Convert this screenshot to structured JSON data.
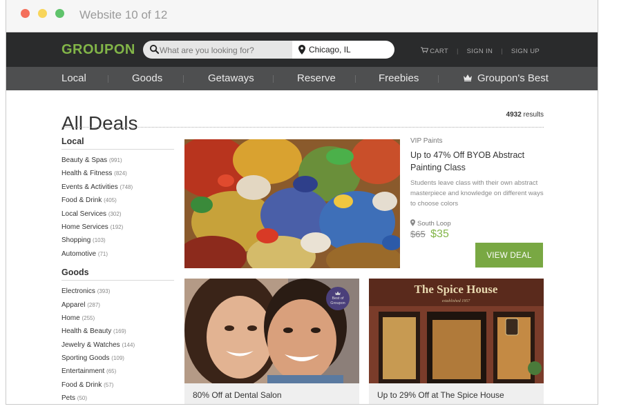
{
  "window": {
    "title": "Website 10 of 12"
  },
  "header": {
    "logo": "GROUPON",
    "search_placeholder": "What are you looking for?",
    "location": "Chicago, IL",
    "links": {
      "cart": "CART",
      "signin": "SIGN IN",
      "signup": "SIGN UP"
    }
  },
  "nav": {
    "items": [
      "Local",
      "Goods",
      "Getaways",
      "Reserve",
      "Freebies",
      "Groupon's Best"
    ]
  },
  "page": {
    "title": "All Deals",
    "results_count": "4932",
    "results_label": "results"
  },
  "sidebar": {
    "groups": [
      {
        "heading": "Local",
        "items": [
          {
            "label": "Beauty & Spas",
            "count": "(991)"
          },
          {
            "label": "Health & Fitness",
            "count": "(824)"
          },
          {
            "label": "Events & Activities",
            "count": "(748)"
          },
          {
            "label": "Food & Drink",
            "count": "(405)"
          },
          {
            "label": "Local Services",
            "count": "(302)"
          },
          {
            "label": "Home Services",
            "count": "(192)"
          },
          {
            "label": "Shopping",
            "count": "(103)"
          },
          {
            "label": "Automotive",
            "count": "(71)"
          }
        ]
      },
      {
        "heading": "Goods",
        "items": [
          {
            "label": "Electronics",
            "count": "(393)"
          },
          {
            "label": "Apparel",
            "count": "(287)"
          },
          {
            "label": "Home",
            "count": "(255)"
          },
          {
            "label": "Health & Beauty",
            "count": "(169)"
          },
          {
            "label": "Jewelry & Watches",
            "count": "(144)"
          },
          {
            "label": "Sporting Goods",
            "count": "(109)"
          },
          {
            "label": "Entertainment",
            "count": "(65)"
          },
          {
            "label": "Food & Drink",
            "count": "(57)"
          },
          {
            "label": "Pets",
            "count": "(50)"
          }
        ]
      }
    ]
  },
  "featured": {
    "merchant": "VIP Paints",
    "title": "Up to 47% Off BYOB Abstract Painting Class",
    "description": "Students leave class with their own abstract masterpiece and knowledge on different ways to choose colors",
    "location": "South Loop",
    "old_price": "$65",
    "new_price": "$35",
    "button": "VIEW DEAL"
  },
  "cards": [
    {
      "caption": "80% Off at Dental Salon",
      "badge_line1": "Best of",
      "badge_line2": "Groupon"
    },
    {
      "caption": "Up to 29% Off at The Spice House",
      "sign_text": "The Spice House",
      "sign_sub": "established 1957"
    }
  ],
  "colors": {
    "brand_green": "#82b548",
    "header_bg": "#2a2b2c",
    "nav_bg": "#4e4f50",
    "button_green": "#79a843"
  }
}
